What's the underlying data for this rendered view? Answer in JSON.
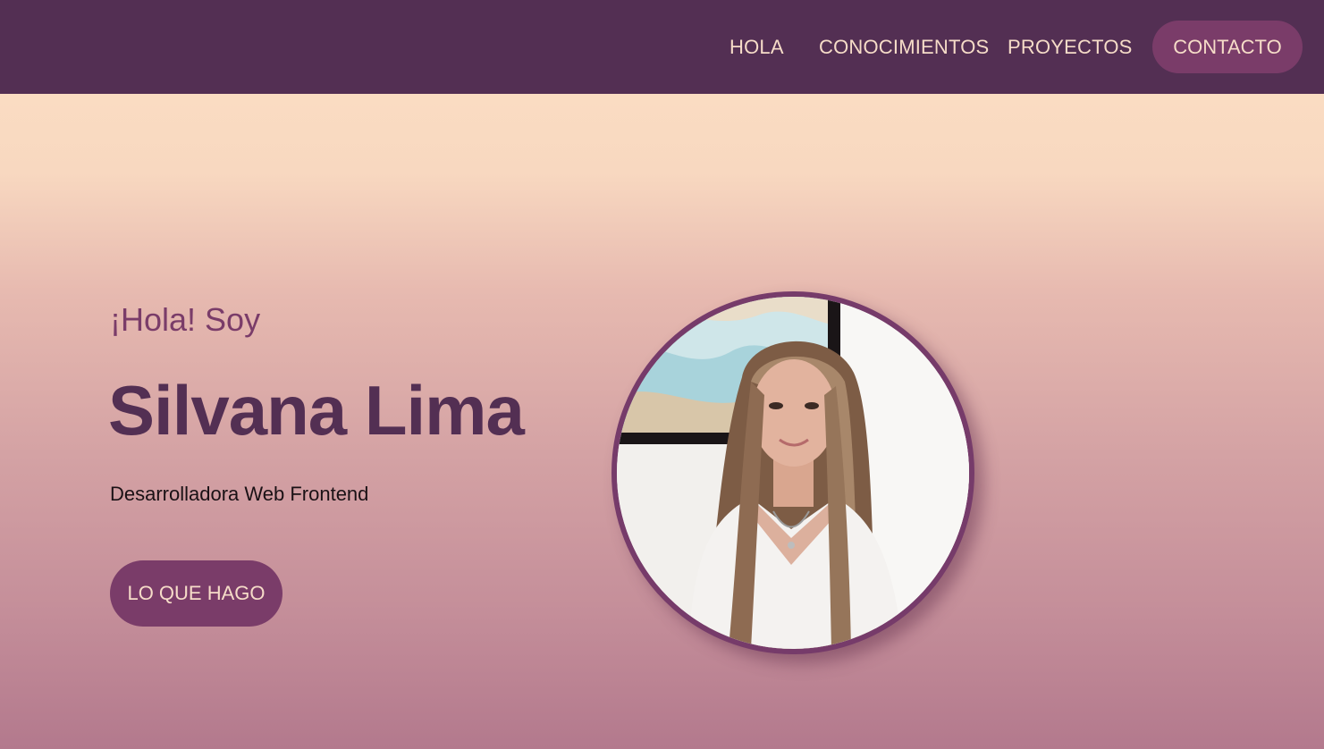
{
  "nav": {
    "links": [
      "HOLA",
      "CONOCIMIENTOS",
      "PROYECTOS"
    ],
    "contact_label": "CONTACTO"
  },
  "hero": {
    "greeting": "¡Hola! Soy",
    "name": "Silvana Lima",
    "role": "Desarrolladora Web Frontend",
    "cta_label": "LO QUE HAGO",
    "photo_icon": "profile-photo"
  },
  "colors": {
    "navbar": "#532f53",
    "accent": "#7a3c69",
    "nav_text": "#f6dcc8",
    "gradient_top": "#fadcc2",
    "gradient_bottom": "#b3798d"
  }
}
